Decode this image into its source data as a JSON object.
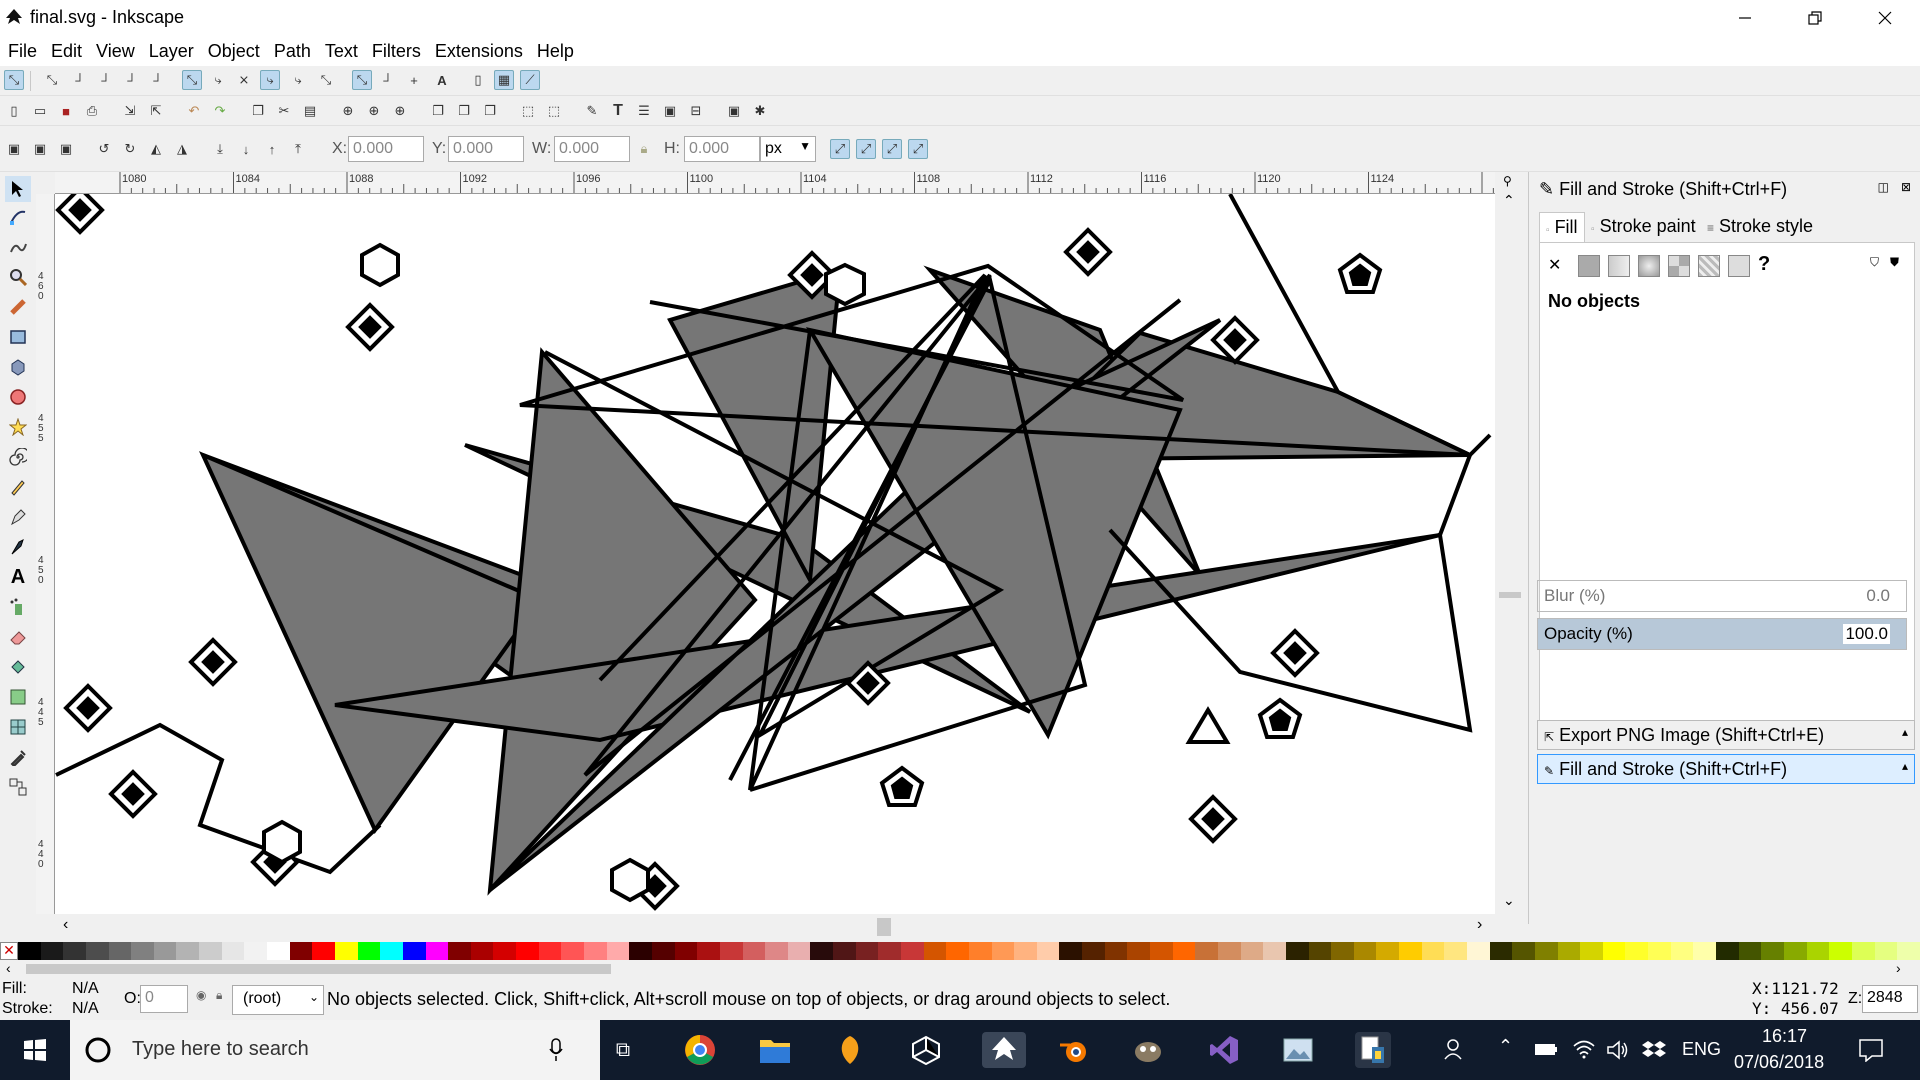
{
  "window": {
    "title": "final.svg - Inkscape",
    "minimize_icon": "minimize-icon",
    "maximize_icon": "restore-icon",
    "close_icon": "close-icon"
  },
  "menu": [
    "File",
    "Edit",
    "View",
    "Layer",
    "Object",
    "Path",
    "Text",
    "Filters",
    "Extensions",
    "Help"
  ],
  "select_toolbar": {
    "x_label": "X:",
    "x_value": "0.000",
    "y_label": "Y:",
    "y_value": "0.000",
    "w_label": "W:",
    "w_value": "0.000",
    "h_label": "H:",
    "h_value": "0.000",
    "unit": "px"
  },
  "ruler": {
    "h_ticks": [
      "1080",
      "1084",
      "1088",
      "1092",
      "1096",
      "1100",
      "1104",
      "1108",
      "1112",
      "1116",
      "1120",
      "1124"
    ],
    "v_ticks": [
      "4\n6\n0",
      "4\n5\n5",
      "4\n5\n0",
      "4\n4\n5",
      "4\n4\n0"
    ]
  },
  "fill_stroke_panel": {
    "header": "Fill and Stroke (Shift+Ctrl+F)",
    "tabs": [
      "Fill",
      "Stroke paint",
      "Stroke style"
    ],
    "paint_buttons": [
      "✕",
      "flat",
      "linear",
      "radial",
      "mesh",
      "pattern",
      "swatch",
      "?"
    ],
    "no_objects": "No objects",
    "blur_label": "Blur (%)",
    "blur_value": "0.0",
    "opacity_label": "Opacity (%)",
    "opacity_value": "100.0"
  },
  "docked_dialogs": [
    "Export PNG Image (Shift+Ctrl+E)",
    "Fill and Stroke (Shift+Ctrl+F)"
  ],
  "statusbar": {
    "fill_label": "Fill:",
    "fill_value": "N/A",
    "stroke_label": "Stroke:",
    "stroke_value": "N/A",
    "opacity_label": "O:",
    "opacity_value": "0",
    "layer": "(root)",
    "message": "No objects selected. Click, Shift+click, Alt+scroll mouse on top of objects, or drag around objects to select.",
    "cursor_x": "X:1121.72",
    "cursor_y": "Y: 456.07",
    "zoom_label": "Z:",
    "zoom_value": "2848"
  },
  "taskbar": {
    "search_placeholder": "Type here to search",
    "language": "ENG",
    "time": "16:17",
    "date": "07/06/2018"
  },
  "palette_colors": [
    "#000000",
    "#1a1a1a",
    "#333333",
    "#4d4d4d",
    "#666666",
    "#808080",
    "#999999",
    "#b3b3b3",
    "#cccccc",
    "#e6e6e6",
    "#f2f2f2",
    "#ffffff",
    "#800000",
    "#ff0000",
    "#ffff00",
    "#00ff00",
    "#00ffff",
    "#0000ff",
    "#ff00ff",
    "#800000",
    "#aa0000",
    "#d40000",
    "#ff0000",
    "#ff2a2a",
    "#ff5555",
    "#ff8080",
    "#ffaaaa",
    "#2b0000",
    "#550000",
    "#800000",
    "#aa1111",
    "#c83737",
    "#d35f5f",
    "#de8787",
    "#e9afaf",
    "#280b0b",
    "#501616",
    "#782121",
    "#a02c2c",
    "#c83737",
    "#d45500",
    "#ff6600",
    "#ff7f2a",
    "#ff9955",
    "#ffb380",
    "#ffccaa",
    "#2b1100",
    "#552200",
    "#803300",
    "#aa4400",
    "#d45500",
    "#ff6600",
    "#c87137",
    "#d38d5f",
    "#deaa87",
    "#e9c6af",
    "#2b2200",
    "#554400",
    "#806600",
    "#aa8800",
    "#d4aa00",
    "#ffcc00",
    "#ffdd55",
    "#ffe680",
    "#fff6d5",
    "#2b2b00",
    "#555500",
    "#808000",
    "#aaaa00",
    "#d4d400",
    "#ffff00",
    "#ffff2a",
    "#ffff55",
    "#ffff80",
    "#ffffaa",
    "#222b00",
    "#445500",
    "#668000",
    "#88aa00",
    "#aad400",
    "#ccff00",
    "#ddff55",
    "#e5ff80",
    "#eeffaa"
  ]
}
